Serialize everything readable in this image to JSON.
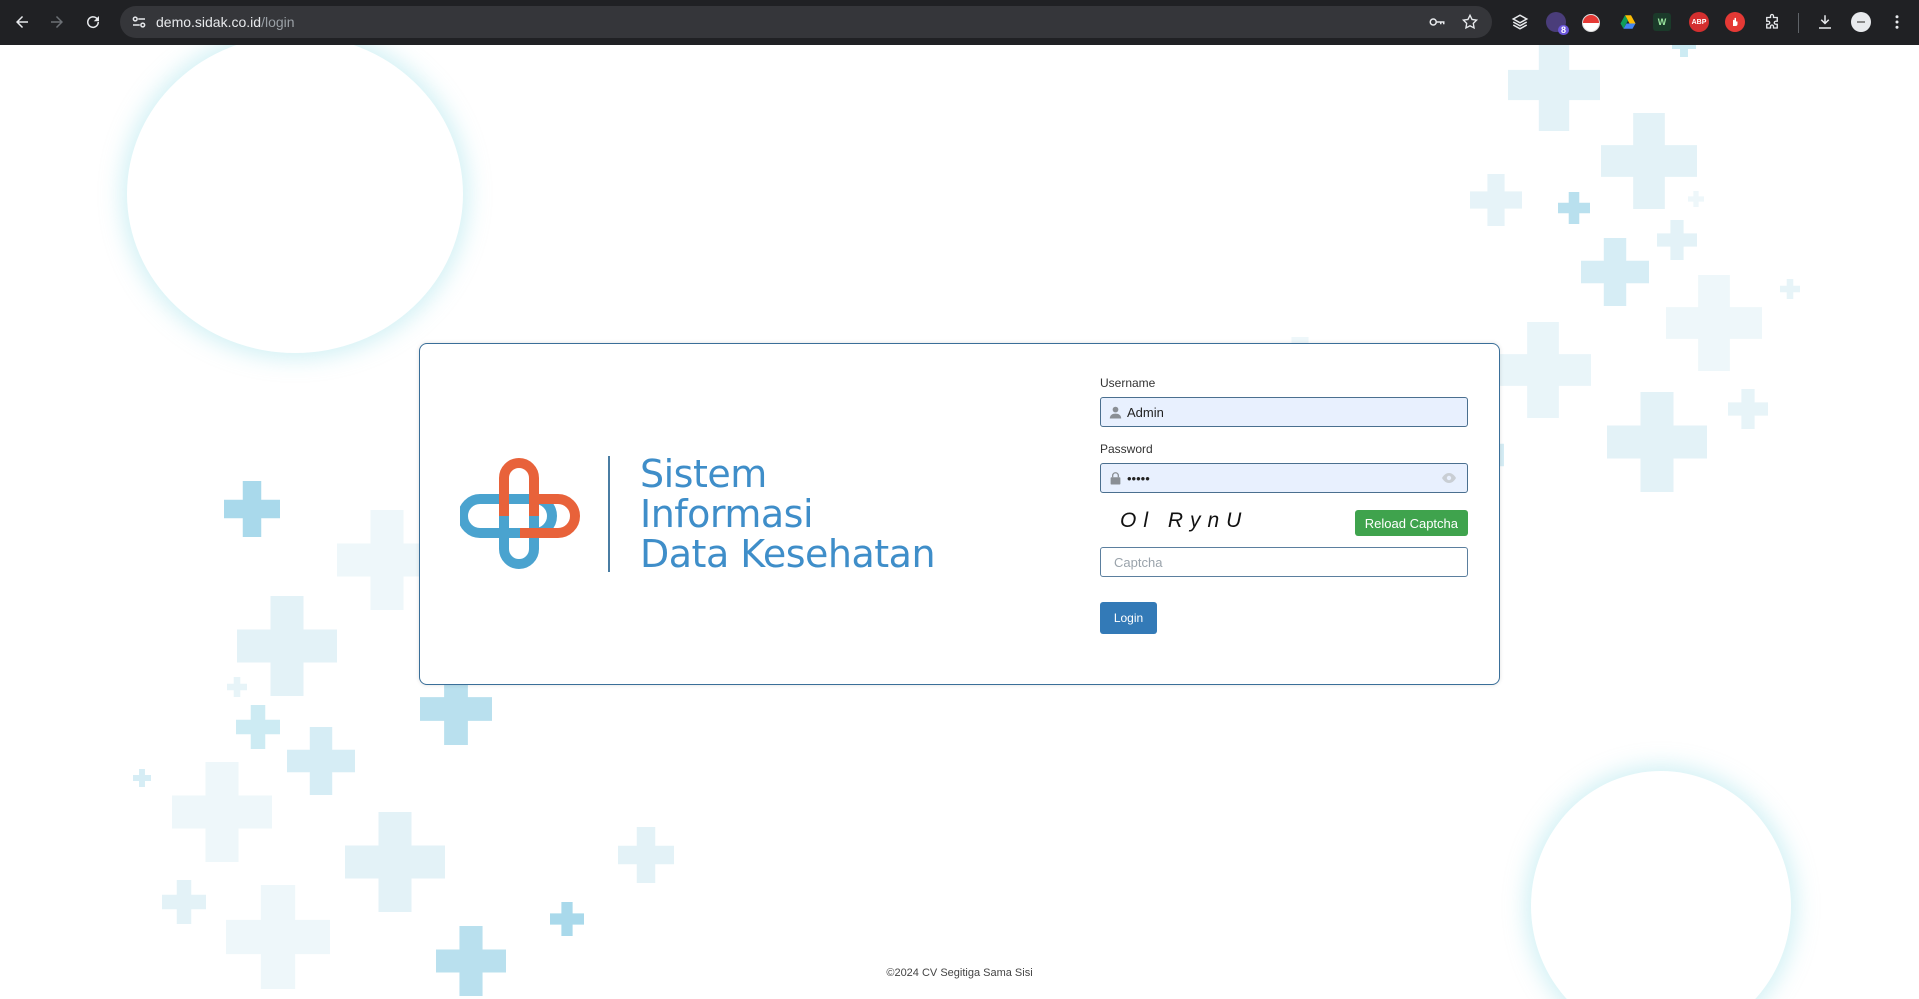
{
  "browser": {
    "url_host": "demo.sidak.co.id",
    "url_path": "/login",
    "extensions": [
      {
        "name": "layers-extension-icon",
        "badge": ""
      },
      {
        "name": "badge-extension-icon",
        "badge": "8"
      },
      {
        "name": "pokeball-extension-icon",
        "badge": ""
      },
      {
        "name": "drive-extension-icon",
        "badge": ""
      },
      {
        "name": "w-extension-icon",
        "badge": "W"
      },
      {
        "name": "adblock-extension-icon",
        "badge": "ABP"
      },
      {
        "name": "hand-extension-icon",
        "badge": ""
      },
      {
        "name": "puzzle-extension-icon",
        "badge": ""
      }
    ]
  },
  "logo": {
    "line1": "Sistem",
    "line2": "Informasi",
    "line3": "Data Kesehatan",
    "colors": {
      "blue": "#4aa3cf",
      "orange": "#e8623a",
      "text": "#3f8ec9"
    }
  },
  "form": {
    "username_label": "Username",
    "username_value": "Admin",
    "password_label": "Password",
    "password_value": "admin",
    "captcha_text": "Ol RynU",
    "reload_label": "Reload Captcha",
    "captcha_placeholder": "Captcha",
    "login_label": "Login"
  },
  "footer": {
    "copyright": "©2024 CV Segitiga Sama Sisi"
  },
  "colors": {
    "accent": "#337ab7",
    "success": "#3fa34d",
    "decor_light": "#e3f3f8",
    "decor_mid": "#b4e0ee",
    "decor_strong": "#8bd0e6"
  }
}
